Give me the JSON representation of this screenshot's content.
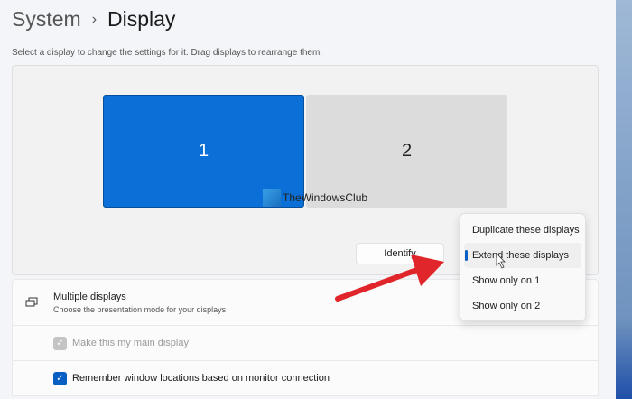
{
  "header": {
    "crumb": "System",
    "title": "Display"
  },
  "description": "Select a display to change the settings for it. Drag displays to rearrange them.",
  "displays": [
    {
      "label": "1",
      "selected": true
    },
    {
      "label": "2",
      "selected": false
    }
  ],
  "watermark": "TheWindowsClub",
  "identify_label": "Identify",
  "multiple_displays": {
    "title": "Multiple displays",
    "subtitle": "Choose the presentation mode for your displays"
  },
  "options": [
    {
      "label": "Make this my main display",
      "checked": true,
      "disabled": true
    },
    {
      "label": "Remember window locations based on monitor connection",
      "checked": true,
      "disabled": false
    }
  ],
  "dropdown": {
    "items": [
      "Duplicate these displays",
      "Extend these displays",
      "Show only on 1",
      "Show only on 2"
    ],
    "selected": "Extend these displays"
  },
  "colors": {
    "accent": "#0a6fd6",
    "arrow": "#e0262b"
  }
}
